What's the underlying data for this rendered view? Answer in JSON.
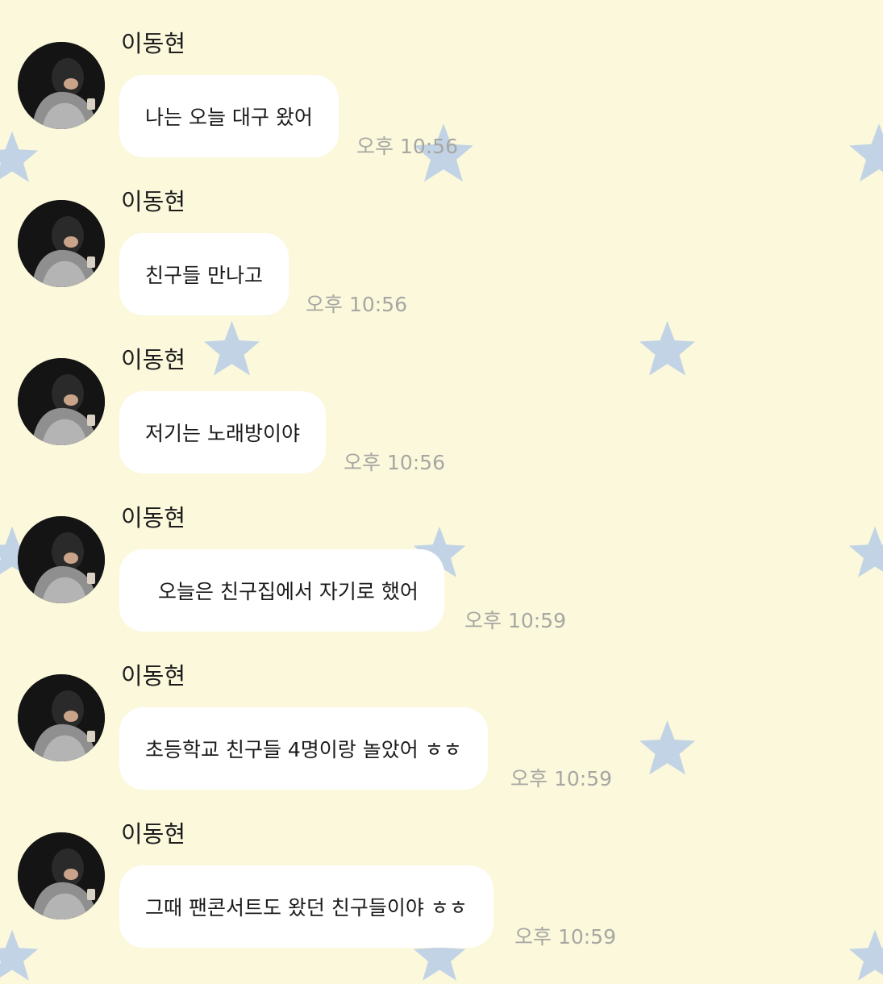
{
  "messages": [
    {
      "sender": "이동현",
      "text": "나는 오늘 대구 왔어",
      "time": "오후 10:56"
    },
    {
      "sender": "이동현",
      "text": "친구들 만나고",
      "time": "오후 10:56"
    },
    {
      "sender": "이동현",
      "text": "저기는 노래방이야",
      "time": "오후 10:56"
    },
    {
      "sender": "이동현",
      "text": "오늘은 친구집에서 자기로 했어",
      "time": "오후 10:59"
    },
    {
      "sender": "이동현",
      "text": "초등학교 친구들 4명이랑 놀았어 ㅎㅎ",
      "time": "오후 10:59"
    },
    {
      "sender": "이동현",
      "text": "그때 팬콘서트도 왔던 친구들이야 ㅎㅎ",
      "time": "오후 10:59"
    }
  ],
  "colors": {
    "background": "#fbf8dc",
    "bubble": "#ffffff",
    "timestamp": "#a7a7a2",
    "star": "#bcd0e6"
  }
}
